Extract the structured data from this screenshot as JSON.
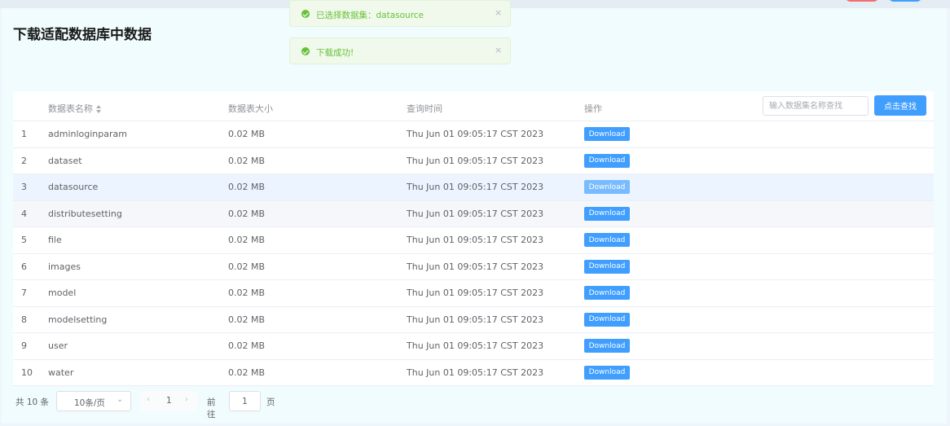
{
  "page": {
    "title": "下载适配数据库中数据"
  },
  "toasts": [
    {
      "message": "已选择数据集：datasource",
      "close_icon": "×"
    },
    {
      "message": "下载成功!",
      "close_icon": "×"
    }
  ],
  "table": {
    "headers": {
      "name": "数据表名称",
      "size": "数据表大小",
      "time": "查询时间",
      "action": "操作"
    },
    "search": {
      "placeholder": "输入数据集名称查找",
      "button_label": "点击查找"
    },
    "rows": [
      {
        "index": "1",
        "name": "adminloginparam",
        "size": "0.02 MB",
        "time": "Thu Jun 01 09:05:17 CST 2023",
        "action": "Download"
      },
      {
        "index": "2",
        "name": "dataset",
        "size": "0.02 MB",
        "time": "Thu Jun 01 09:05:17 CST 2023",
        "action": "Download"
      },
      {
        "index": "3",
        "name": "datasource",
        "size": "0.02 MB",
        "time": "Thu Jun 01 09:05:17 CST 2023",
        "action": "Download"
      },
      {
        "index": "4",
        "name": "distributesetting",
        "size": "0.02 MB",
        "time": "Thu Jun 01 09:05:17 CST 2023",
        "action": "Download"
      },
      {
        "index": "5",
        "name": "file",
        "size": "0.02 MB",
        "time": "Thu Jun 01 09:05:17 CST 2023",
        "action": "Download"
      },
      {
        "index": "6",
        "name": "images",
        "size": "0.02 MB",
        "time": "Thu Jun 01 09:05:17 CST 2023",
        "action": "Download"
      },
      {
        "index": "7",
        "name": "model",
        "size": "0.02 MB",
        "time": "Thu Jun 01 09:05:17 CST 2023",
        "action": "Download"
      },
      {
        "index": "8",
        "name": "modelsetting",
        "size": "0.02 MB",
        "time": "Thu Jun 01 09:05:17 CST 2023",
        "action": "Download"
      },
      {
        "index": "9",
        "name": "user",
        "size": "0.02 MB",
        "time": "Thu Jun 01 09:05:17 CST 2023",
        "action": "Download"
      },
      {
        "index": "10",
        "name": "water",
        "size": "0.02 MB",
        "time": "Thu Jun 01 09:05:17 CST 2023",
        "action": "Download"
      }
    ]
  },
  "pagination": {
    "total": "共 10 条",
    "page_size": "10条/页",
    "page_size_chevron": "⌄",
    "prev_icon": "‹",
    "current_page": "1",
    "next_icon": "›",
    "goto_label": "前往",
    "goto_value": "1",
    "goto_unit": "页"
  },
  "colors": {
    "primary": "#409eff",
    "success": "#67c23a",
    "danger": "#f56c6c",
    "selected_row": "#ecf5ff"
  }
}
